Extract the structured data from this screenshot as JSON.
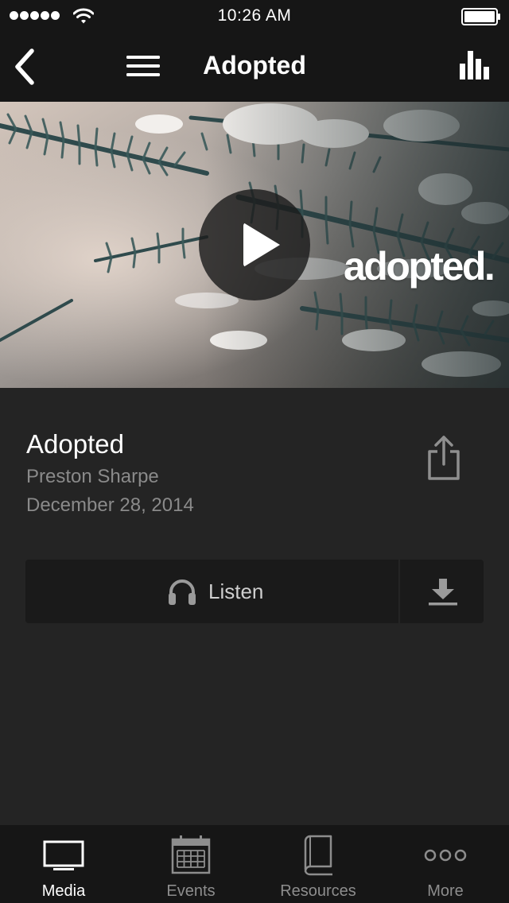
{
  "status_bar": {
    "time": "10:26 AM",
    "signal_bars": 5
  },
  "nav": {
    "title": "Adopted",
    "back_icon": "chevron-left-icon",
    "menu_icon": "hamburger-menu-icon",
    "stats_icon": "bar-chart-icon"
  },
  "hero": {
    "wordmark": "adopted.",
    "play_icon": "play-icon"
  },
  "sermon": {
    "title": "Adopted",
    "speaker": "Preston Sharpe",
    "date": "December 28, 2014",
    "share_icon": "share-icon"
  },
  "actions": {
    "listen_label": "Listen",
    "listen_icon": "headphones-icon",
    "download_icon": "download-icon"
  },
  "tabs": [
    {
      "label": "Media",
      "icon": "tv-icon",
      "active": true
    },
    {
      "label": "Events",
      "icon": "calendar-icon",
      "active": false
    },
    {
      "label": "Resources",
      "icon": "book-icon",
      "active": false
    },
    {
      "label": "More",
      "icon": "more-dots-icon",
      "active": false
    }
  ],
  "colors": {
    "background": "#242424",
    "bars": "#161616",
    "button": "#1a1a1a",
    "primary_text": "#ffffff",
    "secondary_text": "#8a8a8a"
  }
}
